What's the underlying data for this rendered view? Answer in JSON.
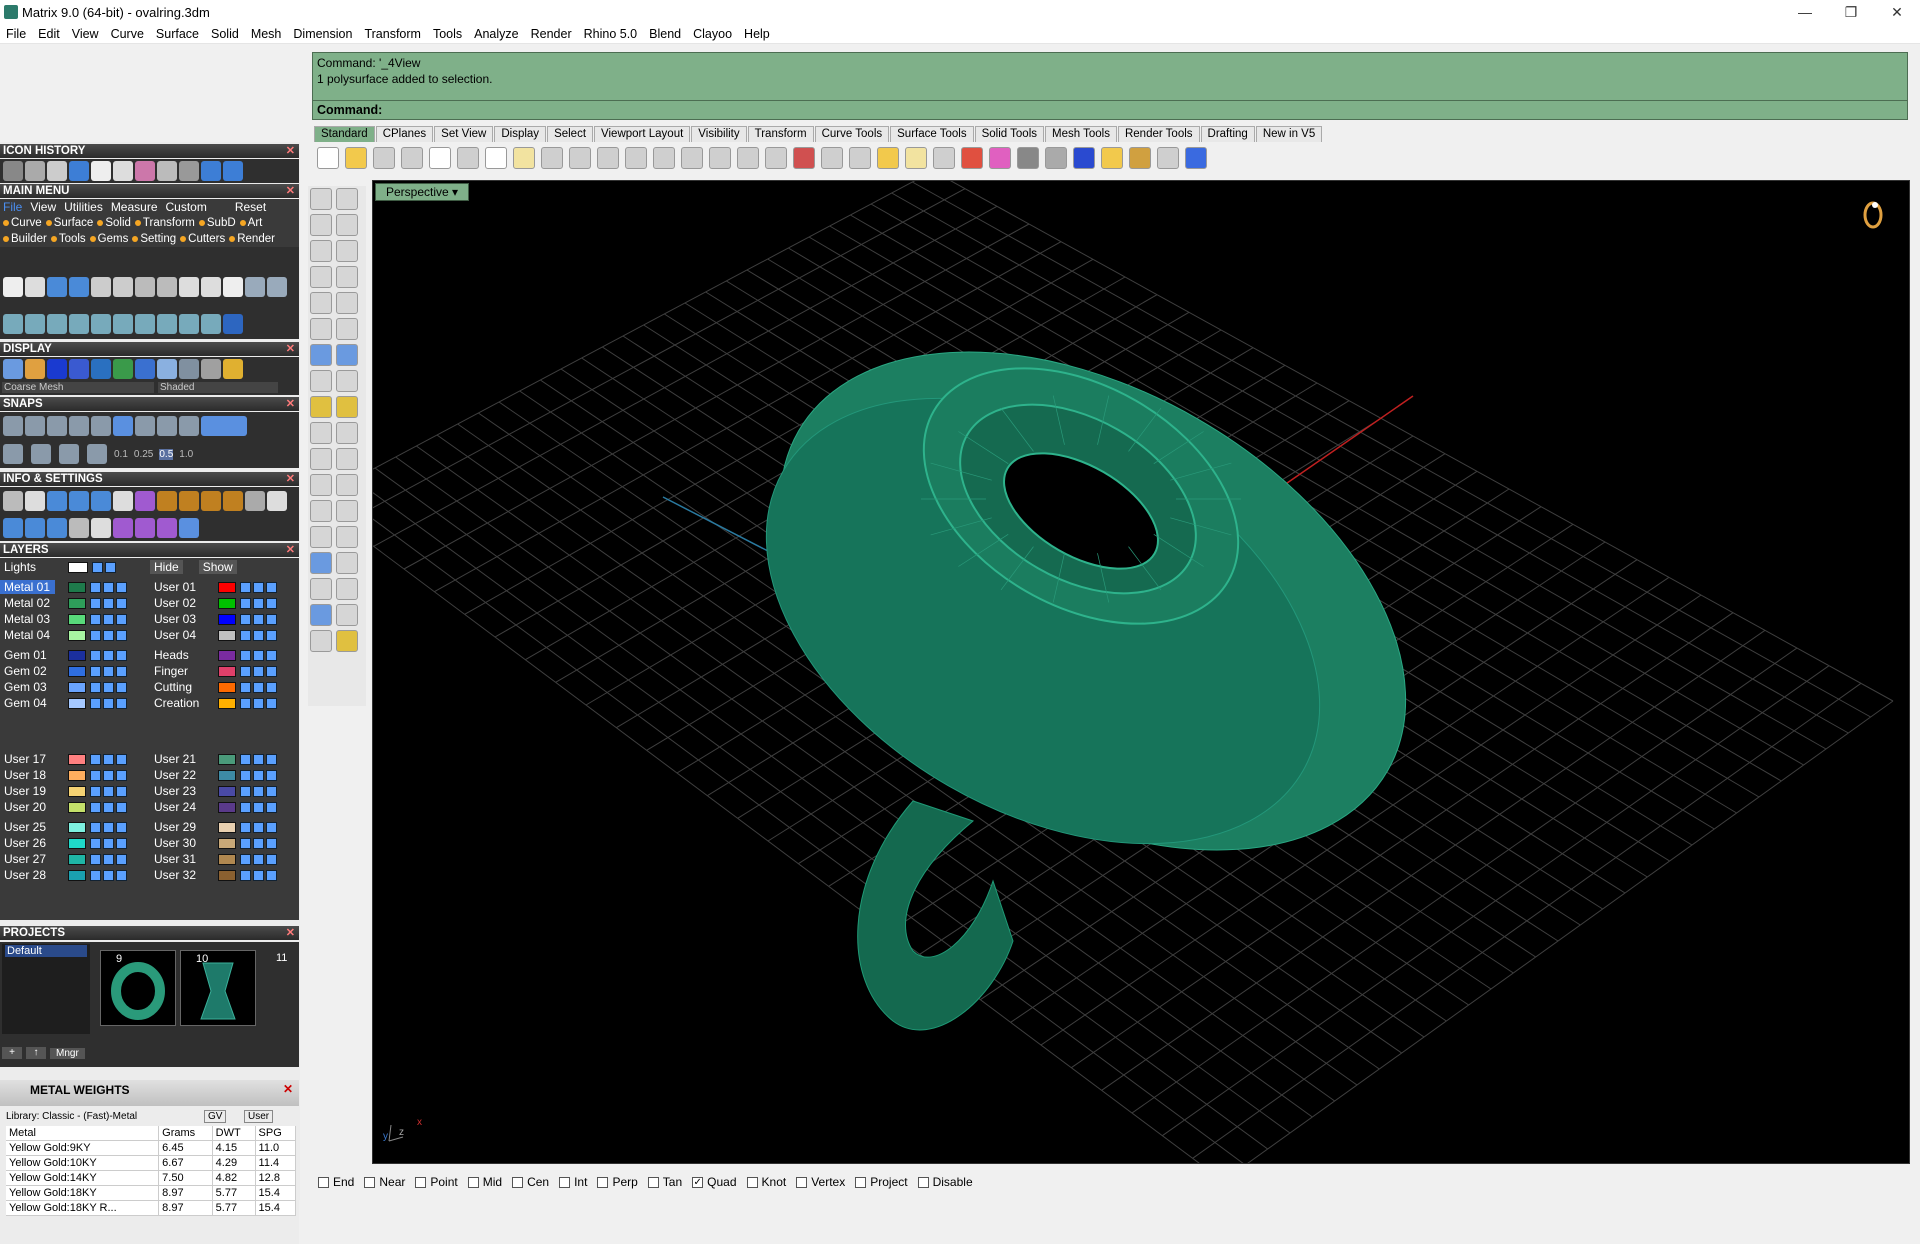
{
  "window": {
    "title": "Matrix 9.0 (64-bit) - ovalring.3dm",
    "min": "—",
    "max": "❐",
    "close": "✕"
  },
  "menu": [
    "File",
    "Edit",
    "View",
    "Curve",
    "Surface",
    "Solid",
    "Mesh",
    "Dimension",
    "Transform",
    "Tools",
    "Analyze",
    "Render",
    "Rhino 5.0",
    "Blend",
    "Clayoo",
    "Help"
  ],
  "panels": {
    "icon_history": "ICON HISTORY",
    "main_menu": "MAIN MENU",
    "main_menu_tabs": [
      "File",
      "View",
      "Utilities",
      "Measure",
      "Custom",
      "Reset"
    ],
    "main_menu_row1": [
      "Curve",
      "Surface",
      "Solid",
      "Transform",
      "SubD",
      "Art"
    ],
    "main_menu_row2": [
      "Builder",
      "Tools",
      "Gems",
      "Setting",
      "Cutters",
      "Render"
    ],
    "display": "DISPLAY",
    "display_mesh": "Coarse Mesh",
    "display_mode": "Shaded",
    "snaps": "SNAPS",
    "snap_values": [
      "0.1",
      "0.25",
      "0.5",
      "1.0"
    ],
    "info_settings": "INFO & SETTINGS",
    "layers": "LAYERS",
    "hide": "Hide",
    "show": "Show",
    "projects": "PROJECTS",
    "project_default": "Default",
    "project_nums": [
      "9",
      "10",
      "11"
    ],
    "mngr": "Mngr",
    "metal_weights": "METAL WEIGHTS",
    "library": "Library: Classic - (Fast)-Metal",
    "gv": "GV",
    "user": "User"
  },
  "layers": {
    "lights": "Lights",
    "left": [
      {
        "name": "Metal 01",
        "color": "#1e7a4b"
      },
      {
        "name": "Metal 02",
        "color": "#2e9e5a"
      },
      {
        "name": "Metal 03",
        "color": "#58d97a"
      },
      {
        "name": "Metal 04",
        "color": "#a8f5a2"
      },
      {
        "name": "Gem 01",
        "color": "#1b2f9e"
      },
      {
        "name": "Gem 02",
        "color": "#2f6ee0"
      },
      {
        "name": "Gem 03",
        "color": "#6aa4ff"
      },
      {
        "name": "Gem 04",
        "color": "#a5c8ff"
      },
      {
        "name": "User 17",
        "color": "#ff8080"
      },
      {
        "name": "User 18",
        "color": "#ffae5e"
      },
      {
        "name": "User 19",
        "color": "#f5d273"
      },
      {
        "name": "User 20",
        "color": "#c4e06a"
      },
      {
        "name": "User 25",
        "color": "#7ef0e0"
      },
      {
        "name": "User 26",
        "color": "#1fd8c8"
      },
      {
        "name": "User 27",
        "color": "#1fb5a5"
      },
      {
        "name": "User 28",
        "color": "#1aa0b0"
      }
    ],
    "right": [
      {
        "name": "User 01",
        "color": "#ff0000"
      },
      {
        "name": "User 02",
        "color": "#00c000"
      },
      {
        "name": "User 03",
        "color": "#0000ff"
      },
      {
        "name": "User 04",
        "color": "#c0c0c0"
      },
      {
        "name": "Heads",
        "color": "#7a2ba0"
      },
      {
        "name": "Finger",
        "color": "#e0406a"
      },
      {
        "name": "Cutting",
        "color": "#ff6a00"
      },
      {
        "name": "Creation",
        "color": "#ffb000"
      },
      {
        "name": "User 21",
        "color": "#4a9a7a"
      },
      {
        "name": "User 22",
        "color": "#3d8aa5"
      },
      {
        "name": "User 23",
        "color": "#4a4aa5"
      },
      {
        "name": "User 24",
        "color": "#5a3a8a"
      },
      {
        "name": "User 29",
        "color": "#e8d0b0"
      },
      {
        "name": "User 30",
        "color": "#c8a878"
      },
      {
        "name": "User 31",
        "color": "#b08850"
      },
      {
        "name": "User 32",
        "color": "#8a6030"
      }
    ]
  },
  "metal_table": {
    "headers": [
      "Metal",
      "Grams",
      "DWT",
      "SPG"
    ],
    "rows": [
      [
        "Yellow Gold:9KY",
        "6.45",
        "4.15",
        "11.0"
      ],
      [
        "Yellow Gold:10KY",
        "6.67",
        "4.29",
        "11.4"
      ],
      [
        "Yellow Gold:14KY",
        "7.50",
        "4.82",
        "12.8"
      ],
      [
        "Yellow Gold:18KY",
        "8.97",
        "5.77",
        "15.4"
      ],
      [
        "Yellow Gold:18KY R...",
        "8.97",
        "5.77",
        "15.4"
      ]
    ]
  },
  "command": {
    "history1": "Command: '_4View",
    "history2": "1 polysurface added to selection.",
    "prompt": "Command:"
  },
  "tabs": [
    "Standard",
    "CPlanes",
    "Set View",
    "Display",
    "Select",
    "Viewport Layout",
    "Visibility",
    "Transform",
    "Curve Tools",
    "Surface Tools",
    "Solid Tools",
    "Mesh Tools",
    "Render Tools",
    "Drafting",
    "New in V5"
  ],
  "viewport": {
    "name": "Perspective",
    "axis_y": "y",
    "axis_z": "z",
    "axis_x": "x"
  },
  "osnaps": [
    {
      "label": "End",
      "checked": false
    },
    {
      "label": "Near",
      "checked": false
    },
    {
      "label": "Point",
      "checked": false
    },
    {
      "label": "Mid",
      "checked": false
    },
    {
      "label": "Cen",
      "checked": false
    },
    {
      "label": "Int",
      "checked": false
    },
    {
      "label": "Perp",
      "checked": false
    },
    {
      "label": "Tan",
      "checked": false
    },
    {
      "label": "Quad",
      "checked": true
    },
    {
      "label": "Knot",
      "checked": false
    },
    {
      "label": "Vertex",
      "checked": false
    },
    {
      "label": "Project",
      "checked": false
    },
    {
      "label": "Disable",
      "checked": false
    }
  ],
  "colors": {
    "accent_green": "#7fb089",
    "model": "#1e8a6a"
  }
}
